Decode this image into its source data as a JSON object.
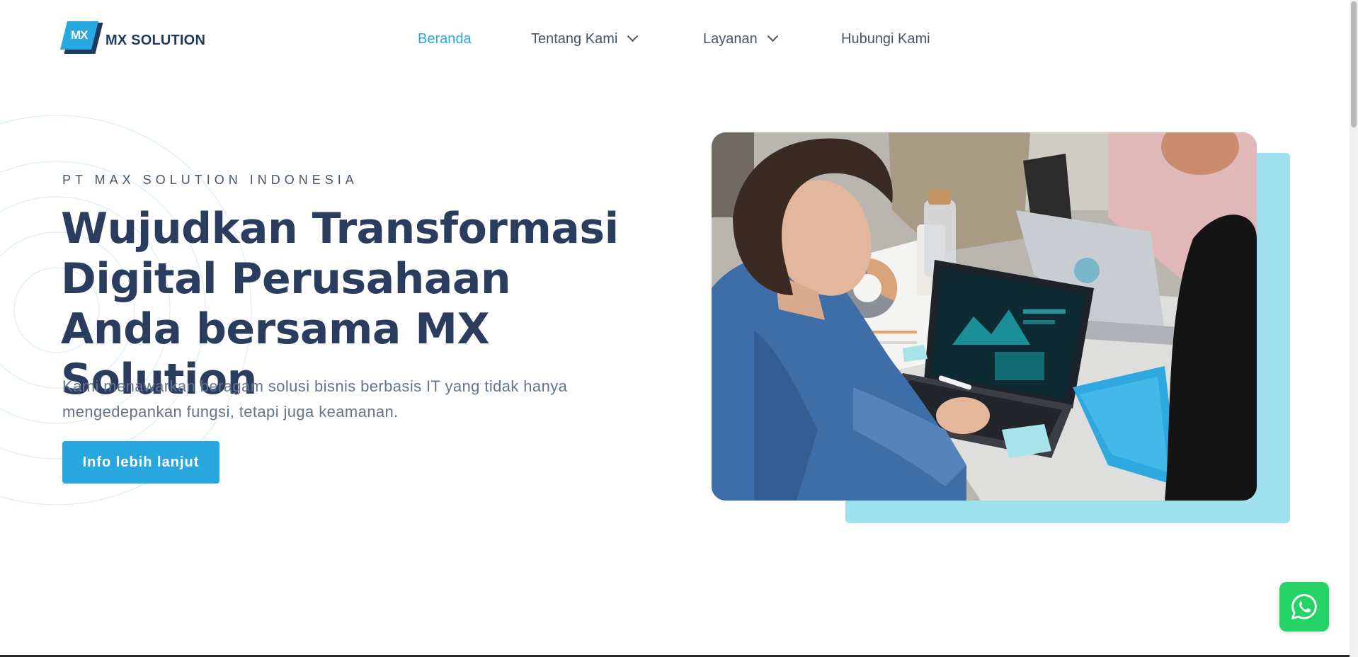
{
  "header": {
    "logo": {
      "mark_text": "MX",
      "brand_name": "MX SOLUTION"
    },
    "nav": {
      "items": [
        {
          "label": "Beranda",
          "active": true,
          "has_dropdown": false
        },
        {
          "label": "Tentang Kami",
          "active": false,
          "has_dropdown": true
        },
        {
          "label": "Layanan",
          "active": false,
          "has_dropdown": true
        },
        {
          "label": "Hubungi Kami",
          "active": false,
          "has_dropdown": false
        }
      ]
    }
  },
  "hero": {
    "eyebrow": "PT MAX SOLUTION INDONESIA",
    "headline": "Wujudkan Transformasi Digital Perusahaan Anda bersama MX Solution",
    "subtext": "Kami menawarkan beragam solusi bisnis berbasis IT yang tidak hanya mengedepankan fungsi, tetapi juga keamanan.",
    "cta_label": "Info lebih lanjut",
    "image_icon": "team-meeting-photo"
  },
  "floating": {
    "whatsapp_icon": "whatsapp-icon"
  },
  "colors": {
    "accent": "#29a7df",
    "heading": "#2b3d5f",
    "body_text": "#64748b",
    "image_backdrop": "#9fe0ee",
    "whatsapp": "#25d366"
  }
}
